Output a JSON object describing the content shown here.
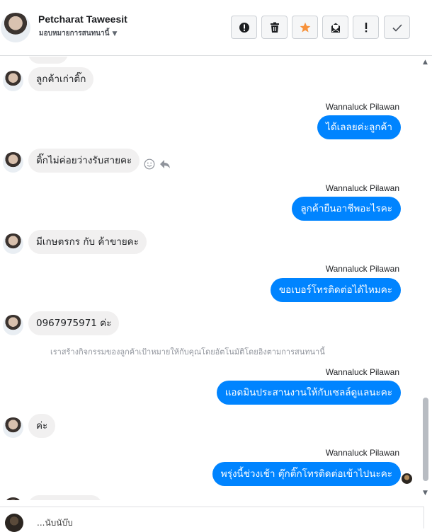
{
  "header": {
    "name": "Petcharat Taweesit",
    "subtitle": "มอบหมายการสนทนานี้",
    "subtitle_caret": "▼",
    "toolbar": [
      {
        "name": "alert-circle",
        "icon": "alert-circle-icon"
      },
      {
        "name": "delete",
        "icon": "trash-icon"
      },
      {
        "name": "star",
        "icon": "star-icon",
        "color": "#f7923b"
      },
      {
        "name": "mark-unread",
        "icon": "envelope-icon"
      },
      {
        "name": "important",
        "icon": "exclamation-icon"
      },
      {
        "name": "done",
        "icon": "check-icon"
      }
    ]
  },
  "colors": {
    "outgoing_bubble": "#0084ff",
    "incoming_bubble": "#f1f0f0",
    "star": "#f7923b"
  },
  "messages": {
    "m1": "ลูกค้าเก่าติ๊ก",
    "m2_sender": "Wannaluck Pilawan",
    "m2": "ได้เลลยค่ะลูกค้า",
    "m3": "ติ๊กไม่ค่อยว่างรับสายคะ",
    "m4_sender": "Wannaluck Pilawan",
    "m4": "ลูกค้ายืนอาชีพอะไรคะ",
    "m5": "มีเกษตรกร  กับ   ค้าขายคะ",
    "m6_sender": "Wannaluck Pilawan",
    "m6": "ขอเบอร์โทรติดต่อได้ไหมคะ",
    "m7": "0967975971  ค่ะ",
    "system_note": "เราสร้างกิจกรรมของลูกค้าเป้าหมายให้กับคุณโดยอัตโนมัติโดยอิงตามการสนทนานี้",
    "m8_sender": "Wannaluck Pilawan",
    "m8": "แอดมินประสานงานให้กับเซลล์ดูแลนะคะ",
    "m9": "ค่ะ",
    "m10_sender": "Wannaluck Pilawan",
    "m10": "พรุ่งนี้ช่วงเช้า  ตุ๊กติ๊กโทรติดต่อเข้าไปนะคะ"
  },
  "composer": {
    "text": "...นับนับ๊บ"
  }
}
